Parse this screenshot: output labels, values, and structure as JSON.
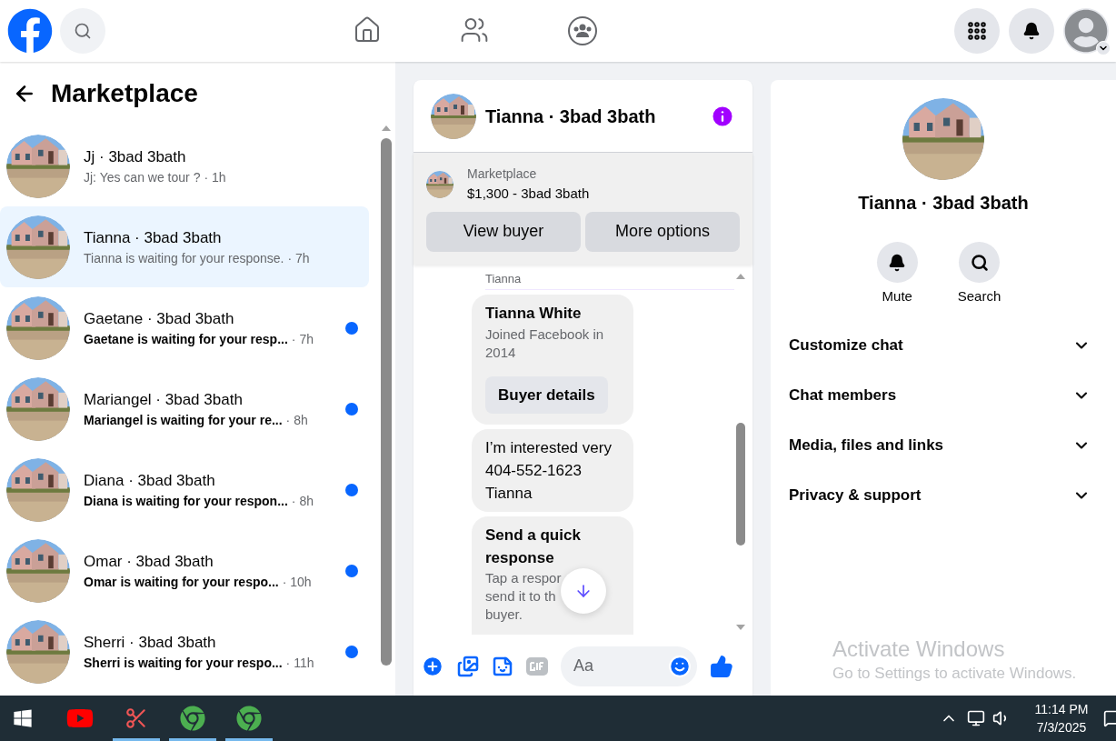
{
  "sidebar": {
    "title": "Marketplace",
    "conversations": [
      {
        "name": "Jj · 3bad 3bath",
        "preview": "Jj: Yes can we tour ?",
        "time": "· 1h",
        "unread": false,
        "selected": false
      },
      {
        "name": "Tianna · 3bad 3bath",
        "preview": "Tianna is waiting for your response.",
        "time": "· 7h",
        "unread": false,
        "selected": true
      },
      {
        "name": "Gaetane · 3bad 3bath",
        "preview": "Gaetane is waiting for your resp...",
        "time": "· 7h",
        "unread": true,
        "selected": false
      },
      {
        "name": "Mariangel · 3bad 3bath",
        "preview": "Mariangel is waiting for your re...",
        "time": "· 8h",
        "unread": true,
        "selected": false
      },
      {
        "name": "Diana · 3bad 3bath",
        "preview": "Diana is waiting for your respon...",
        "time": "· 8h",
        "unread": true,
        "selected": false
      },
      {
        "name": "Omar · 3bad 3bath",
        "preview": "Omar is waiting for your respo...",
        "time": "· 10h",
        "unread": true,
        "selected": false
      },
      {
        "name": "Sherri · 3bad 3bath",
        "preview": "Sherri is waiting for your respo...",
        "time": "· 11h",
        "unread": true,
        "selected": false
      }
    ]
  },
  "chat": {
    "title": "Tianna · 3bad 3bath",
    "listing": {
      "label": "Marketplace",
      "price": "$1,300 - 3bad 3bath"
    },
    "actions": [
      "View buyer",
      "More options"
    ],
    "sender": "Tianna",
    "messages": [
      {
        "kind": "profile",
        "title": "Tianna White",
        "subtitle": "Joined Facebook in 2014",
        "button": "Buyer details"
      },
      {
        "kind": "text",
        "text": "I’m interested very  404-552-1623 Tianna"
      },
      {
        "kind": "quick",
        "title": "Send a quick response",
        "lines": [
          "Tap a respor",
          "send it to th",
          "buyer."
        ]
      }
    ],
    "composer": {
      "placeholder": "Aa"
    }
  },
  "details": {
    "name": "Tianna · 3bad 3bath",
    "actions": [
      {
        "kind": "mute",
        "label": "Mute"
      },
      {
        "kind": "search",
        "label": "Search"
      }
    ],
    "sections": [
      {
        "label": "Customize chat",
        "expanded": false
      },
      {
        "label": "Chat members",
        "expanded": false
      },
      {
        "label": "Media, files and links",
        "expanded": false
      },
      {
        "label": "Privacy & support",
        "expanded": false
      }
    ]
  },
  "activation_notice": {
    "title": "Activate Windows",
    "subtitle": "Go to Settings to activate Windows."
  },
  "taskbar": {
    "apps": [
      {
        "kind": "youtube",
        "running": false
      },
      {
        "kind": "snip",
        "running": true
      },
      {
        "kind": "chrome",
        "running": true
      },
      {
        "kind": "chrome",
        "running": true
      }
    ],
    "time": "11:14 PM",
    "date": "7/3/2025"
  }
}
